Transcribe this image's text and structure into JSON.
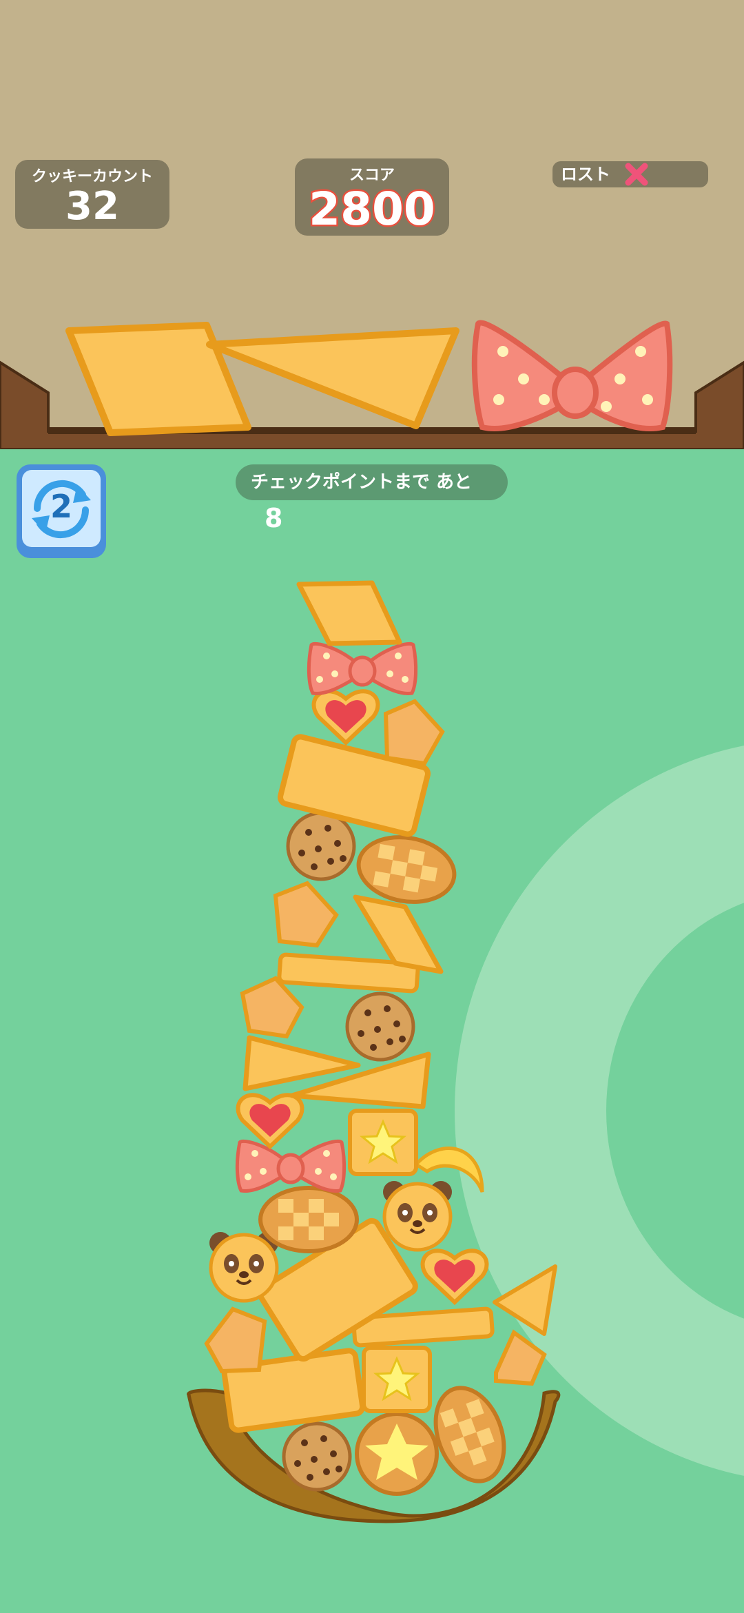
{
  "hud": {
    "cookie_count_label": "クッキーカウント",
    "cookie_count_value": "32",
    "score_label": "スコア",
    "score_value": "2800",
    "lost_label": "ロスト",
    "lost_icon": "x-mark-icon"
  },
  "queue": {
    "pieces": [
      "rhombus-cookie",
      "triangle-cookie",
      "ribbon-bow-cookie"
    ]
  },
  "checkpoint": {
    "label": "チェックポイントまで あと",
    "remaining": "8"
  },
  "undo": {
    "count": "2",
    "icon": "refresh-arrows-icon"
  },
  "colors": {
    "sky": "#c2b28c",
    "grass": "#74d19c",
    "cookie": "#fbc45a",
    "cookie_edge": "#e79b1c",
    "score_outline": "#e8503e",
    "lost_x": "#f0537a",
    "bowl": "#a5741d"
  }
}
